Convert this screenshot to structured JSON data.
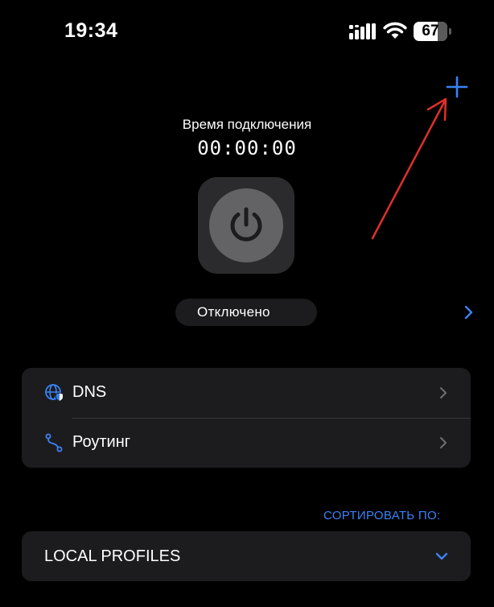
{
  "status_bar": {
    "time": "19:34",
    "battery_level": "67"
  },
  "connection": {
    "label": "Время подключения",
    "timer": "00:00:00",
    "status": "Отключено"
  },
  "settings": {
    "items": [
      {
        "label": "DNS",
        "icon": "globe-shield-icon"
      },
      {
        "label": "Роутинг",
        "icon": "route-icon"
      }
    ]
  },
  "sort": {
    "label": "СОРТИРОВАТЬ ПО:"
  },
  "profiles": {
    "label": "LOCAL PROFILES"
  },
  "colors": {
    "accent": "#3a82f7",
    "background": "#000000",
    "card": "#1c1c1e",
    "annotation": "#e0302a"
  }
}
